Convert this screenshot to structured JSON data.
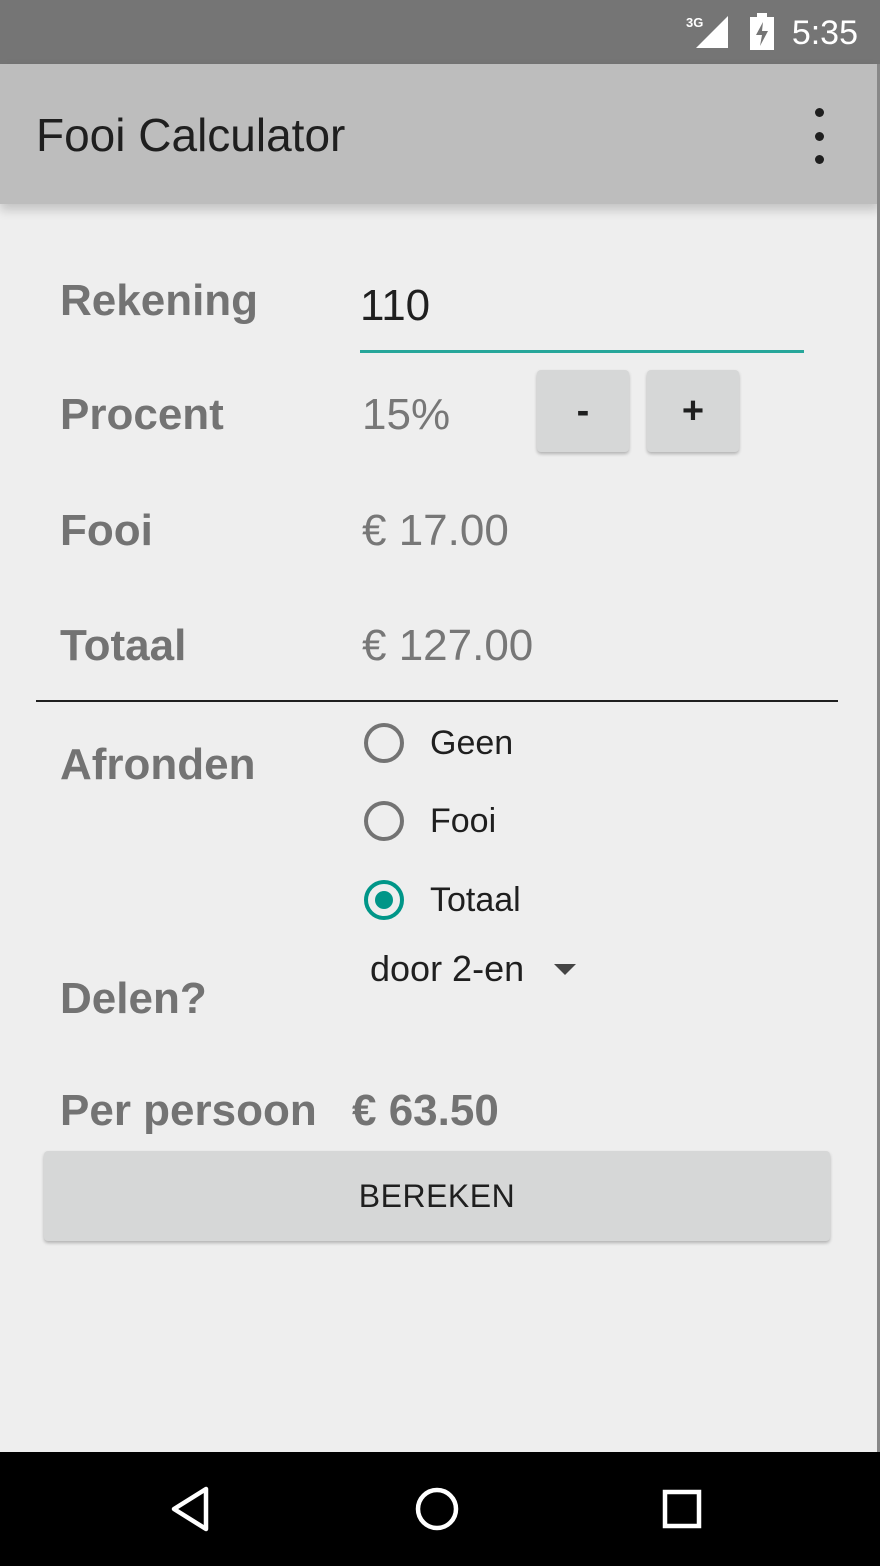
{
  "status_bar": {
    "network_label": "3G",
    "time": "5:35"
  },
  "app_bar": {
    "title": "Fooi Calculator",
    "overflow_icon": "more-vertical-icon"
  },
  "form": {
    "bill": {
      "label": "Rekening",
      "value": "110"
    },
    "percent": {
      "label": "Procent",
      "value": "15%",
      "minus_label": "-",
      "plus_label": "+"
    },
    "tip": {
      "label": "Fooi",
      "value": "€ 17.00"
    },
    "total": {
      "label": "Totaal",
      "value": "€ 127.00"
    },
    "rounding": {
      "label": "Afronden",
      "options": [
        {
          "label": "Geen",
          "checked": false
        },
        {
          "label": "Fooi",
          "checked": false
        },
        {
          "label": "Totaal",
          "checked": true
        }
      ]
    },
    "split": {
      "label": "Delen?",
      "selected": "door 2-en"
    },
    "per_person": {
      "label": "Per persoon",
      "value": "€ 63.50"
    },
    "calculate_button": "BEREKEN"
  },
  "nav_bar": {
    "back_icon": "back-triangle-icon",
    "home_icon": "home-circle-icon",
    "recents_icon": "recents-square-icon"
  },
  "colors": {
    "accent": "#009688",
    "app_bar": "#bdbdbd",
    "status_bar": "#757575",
    "background": "#eeeeee"
  }
}
